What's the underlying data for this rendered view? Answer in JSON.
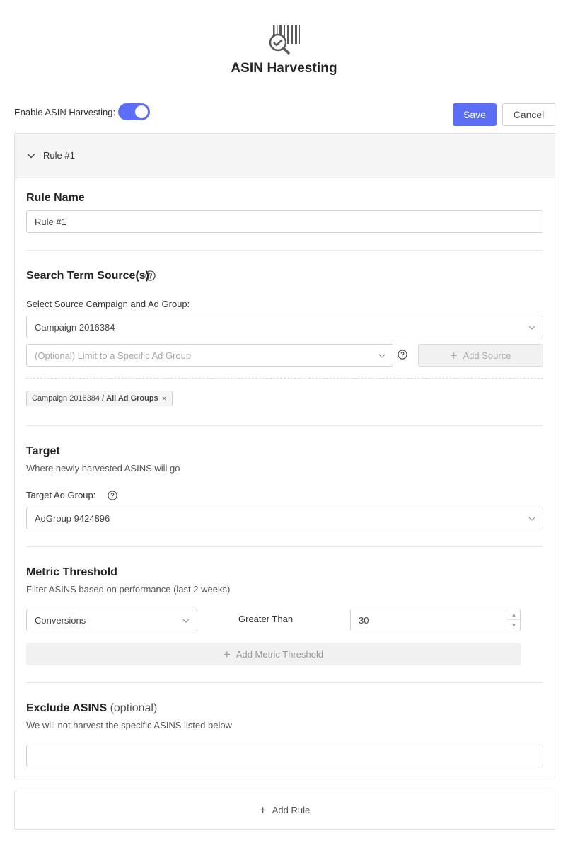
{
  "header": {
    "title": "ASIN Harvesting",
    "logo_icon": "barcode-search-icon"
  },
  "toolbar": {
    "enable_label": "Enable ASIN Harvesting:",
    "enabled": true,
    "save_label": "Save",
    "cancel_label": "Cancel",
    "accent_color": "#5b6ef5"
  },
  "rule": {
    "header_title": "Rule #1",
    "name": {
      "label": "Rule Name",
      "value": "Rule #1"
    },
    "source": {
      "title": "Search Term Source(s)",
      "field_label": "Select Source Campaign and Ad Group:",
      "campaign_value": "Campaign 2016384",
      "ad_group_placeholder": "(Optional) Limit to a Specific Ad Group",
      "add_source_label": "Add Source",
      "chip_campaign": "Campaign 2016384 /",
      "chip_group": "All Ad Groups",
      "chip_remove": "×"
    },
    "target": {
      "title": "Target",
      "subtitle": "Where newly harvested ASINS will go",
      "field_label": "Target Ad Group:",
      "value": "AdGroup 9424896"
    },
    "metric": {
      "title": "Metric Threshold",
      "subtitle": "Filter ASINS based on performance (last 2 weeks)",
      "metric_value": "Conversions",
      "operator_label": "Greater Than",
      "threshold_value": "30",
      "add_label": "Add Metric Threshold"
    },
    "exclude": {
      "title": "Exclude ASINS",
      "optional_label": "(optional)",
      "subtitle": "We will not harvest the specific ASINS listed below",
      "value": ""
    }
  },
  "footer": {
    "add_rule_label": "Add Rule"
  }
}
